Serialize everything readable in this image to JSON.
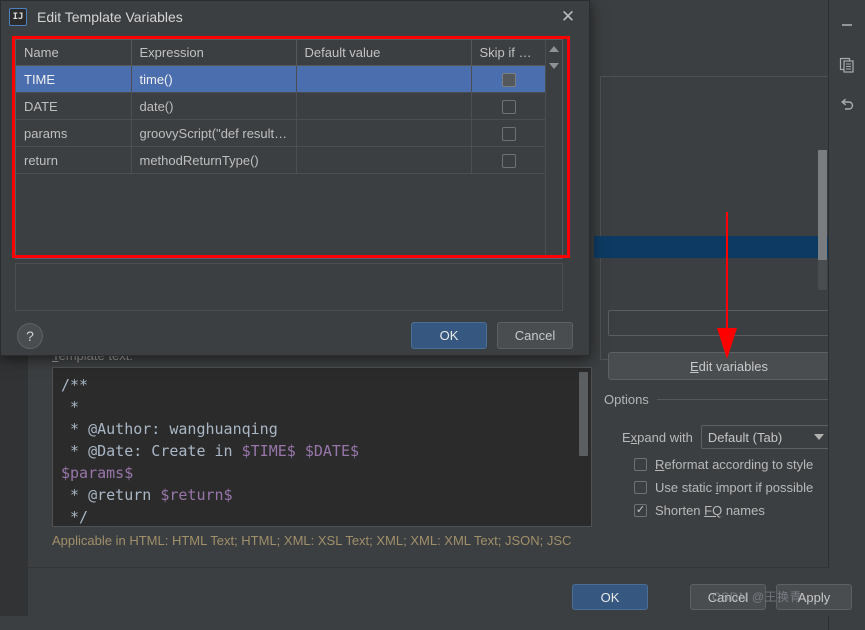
{
  "background": {
    "right_toolbar": [
      {
        "name": "minimize-icon",
        "glyph": "—"
      },
      {
        "name": "copy-icon",
        "glyph": "❐"
      },
      {
        "name": "undo-icon",
        "glyph": "↶"
      }
    ],
    "template_text_label": "Template text:",
    "code_lines": [
      [
        {
          "t": "/**",
          "k": "plain"
        }
      ],
      [
        {
          "t": " *",
          "k": "plain"
        }
      ],
      [
        {
          "t": " * @Author: wanghuanqing",
          "k": "plain"
        }
      ],
      [
        {
          "t": " * @Date: Create in ",
          "k": "plain"
        },
        {
          "t": "$TIME$ $DATE$",
          "k": "var"
        }
      ],
      [
        {
          "t": "$params$",
          "k": "var"
        }
      ],
      [
        {
          "t": " * @return ",
          "k": "plain"
        },
        {
          "t": "$return$",
          "k": "var"
        }
      ],
      [
        {
          "t": " */",
          "k": "plain"
        }
      ]
    ],
    "applicable_text": "Applicable in HTML: HTML Text; HTML; XML: XSL Text; XML; XML: XML Text; JSON; JSC",
    "edit_variables_button": {
      "mnemonic": "E",
      "rest": "dit variables"
    },
    "options": {
      "title": "Options",
      "expand_with_label": {
        "pre": "E",
        "mnemonic": "x",
        "post": "pand with"
      },
      "expand_with_value": "Default (Tab)",
      "checkboxes": [
        {
          "pre": "",
          "mnemonic": "R",
          "post": "eformat according to style",
          "checked": false
        },
        {
          "pre": "Use static ",
          "mnemonic": "i",
          "post": "mport if possible",
          "checked": false
        },
        {
          "pre": "Shorten ",
          "mnemonic": "FQ",
          "post": " names",
          "checked": true
        }
      ]
    },
    "bottom_buttons": {
      "ok": "OK",
      "cancel": "Cancel",
      "apply": "Apply"
    },
    "watermark": "CSDN @王换青"
  },
  "dialog": {
    "icon": "IJ",
    "title": "Edit Template Variables",
    "close_glyph": "✕",
    "columns": [
      "Name",
      "Expression",
      "Default value",
      "Skip if defi..."
    ],
    "rows": [
      {
        "name": "TIME",
        "expression": "time()",
        "default": "",
        "skip": false,
        "selected": true
      },
      {
        "name": "DATE",
        "expression": "date()",
        "default": "",
        "skip": false,
        "selected": false
      },
      {
        "name": "params",
        "expression": "groovyScript(\"def result…",
        "default": "",
        "skip": false,
        "selected": false
      },
      {
        "name": "return",
        "expression": "methodReturnType()",
        "default": "",
        "skip": false,
        "selected": false
      }
    ],
    "help_glyph": "?",
    "ok": "OK",
    "cancel": "Cancel"
  },
  "colors": {
    "window_bg": "#3c3f41",
    "selection_blue": "#4b6eaf",
    "default_button_blue": "#365880",
    "annotation_red": "#fe0000",
    "code_bg": "#2b2b2b",
    "code_variable": "#9876aa",
    "applicable_text": "#a08f6a"
  }
}
